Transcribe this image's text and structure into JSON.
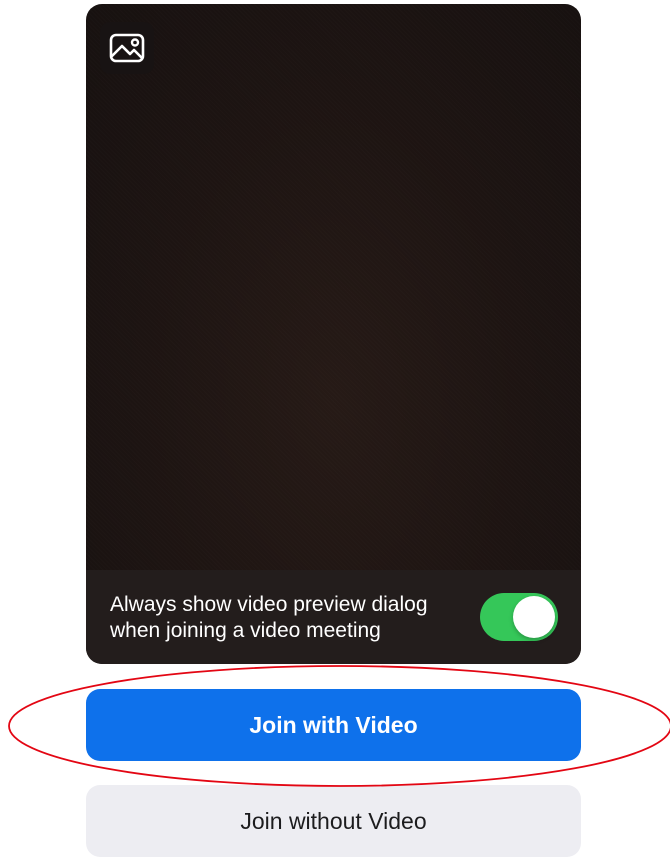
{
  "preview": {
    "background_icon": "image-icon",
    "option": {
      "line1": "Always show video preview dialog",
      "line2": "when joining a video meeting",
      "toggle_on": true
    }
  },
  "actions": {
    "join_with_video": "Join with Video",
    "join_without_video": "Join without Video"
  },
  "colors": {
    "primary": "#0e71eb",
    "toggle_on": "#35c759",
    "annotation": "#e30613"
  }
}
